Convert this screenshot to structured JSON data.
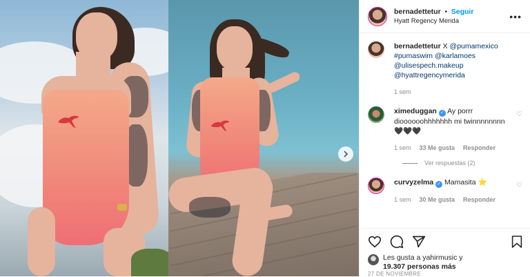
{
  "header": {
    "username": "bernadettetur",
    "separator": "•",
    "follow_label": "Seguir",
    "location": "Hyatt Regency Merida",
    "more_icon": "more-horizontal-icon"
  },
  "caption": {
    "username": "bernadettetur",
    "text_prefix": "X",
    "mentions": [
      "@pumamexico",
      "#pumaswim",
      "@karlamoes",
      "@ulisespech.makeup",
      "@hyattregencymerida"
    ],
    "time": "1 sem"
  },
  "comments": [
    {
      "username": "ximeduggan",
      "verified": true,
      "text": "Ay porrr dioooooohhhhhhh mi twinnnnnnnn 🖤🖤🖤",
      "time": "1 sem",
      "likes": "33 Me gusta",
      "reply": "Responder",
      "view_replies": "Ver respuestas (2)"
    },
    {
      "username": "curvyzelma",
      "verified": true,
      "text": "Mamasita ⭐",
      "time": "1 sem",
      "likes": "30 Me gusta",
      "reply": "Responder"
    }
  ],
  "likes": {
    "line1": "Les gusta a yahirmusic y",
    "line2": "19.307 personas más"
  },
  "date": "27 DE NOVIEMBRE",
  "colors": {
    "accent": "#0095f6",
    "verified": "#3897f0",
    "swimsuit": "#f08a7a",
    "logo": "#d8383f"
  }
}
